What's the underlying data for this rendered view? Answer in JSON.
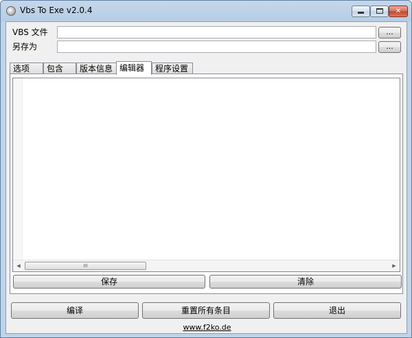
{
  "window": {
    "title": "Vbs To Exe v2.0.4",
    "close_glyph": "✕"
  },
  "fields": {
    "vbs_file_label": "VBS 文件",
    "vbs_file_value": "",
    "save_as_label": "另存为",
    "save_as_value": "",
    "browse_label": "..."
  },
  "tabs": [
    {
      "label": "选项",
      "active": false
    },
    {
      "label": "包含",
      "active": false
    },
    {
      "label": "版本信息",
      "active": false
    },
    {
      "label": "编辑器",
      "active": true
    },
    {
      "label": "程序设置",
      "active": false
    }
  ],
  "editor": {
    "content": "",
    "scroll_left_glyph": "◀",
    "scroll_right_glyph": "▶",
    "thumb_grip": "III"
  },
  "editor_buttons": {
    "save": "保存",
    "clear": "清除"
  },
  "bottom_buttons": {
    "compile": "编译",
    "reset_all": "重置所有条目",
    "exit": "退出"
  },
  "footer": {
    "link": "www.f2ko.de"
  },
  "icons": [
    "app-icon",
    "minimize-icon",
    "maximize-icon",
    "close-icon",
    "scroll-left-icon",
    "scroll-right-icon"
  ]
}
